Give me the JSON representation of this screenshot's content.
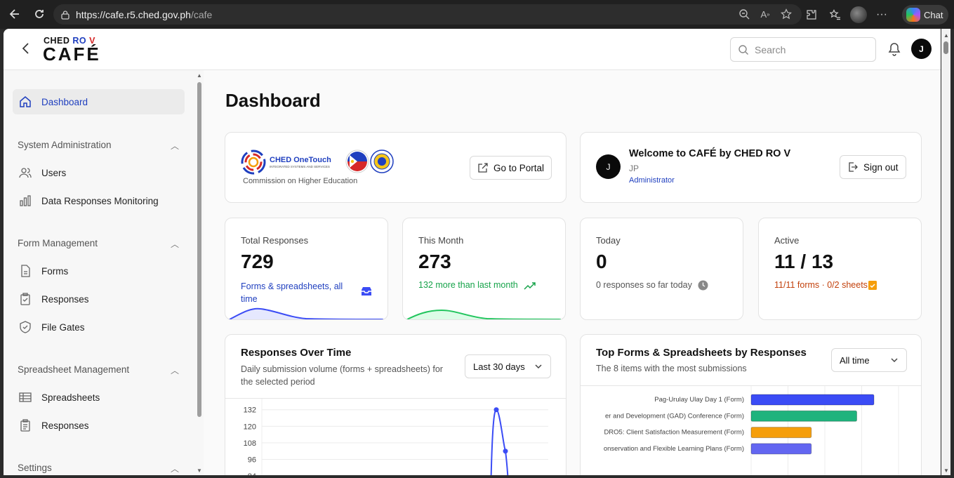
{
  "browser": {
    "url_host": "https://cafe.r5.ched.gov.ph",
    "url_path": "/cafe",
    "chat_label": "Chat"
  },
  "header": {
    "logo_top_ched": "CHED",
    "logo_top_ro": "RO",
    "logo_top_v": "V",
    "logo_main": "CAFÉ",
    "search_placeholder": "Search",
    "avatar_initial": "J"
  },
  "sidebar": {
    "dashboard": "Dashboard",
    "groups": {
      "system": "System Administration",
      "form": "Form Management",
      "spreadsheet": "Spreadsheet Management",
      "settings": "Settings"
    },
    "items": {
      "users": "Users",
      "data_monitoring": "Data Responses Monitoring",
      "forms": "Forms",
      "responses": "Responses",
      "file_gates": "File Gates",
      "spreadsheets": "Spreadsheets",
      "sheet_responses": "Responses"
    }
  },
  "main": {
    "title": "Dashboard",
    "portal_card": {
      "logo_text": "CHED OneTouch",
      "logo_sub": "INTEGRATED SYSTEMS AND SERVICES",
      "caption": "Commission on Higher Education",
      "button": "Go to Portal"
    },
    "welcome_card": {
      "avatar_initial": "J",
      "title": "Welcome to CAFÉ by CHED RO V",
      "name": "JP",
      "role": "Administrator",
      "button": "Sign out"
    },
    "stats": [
      {
        "label": "Total Responses",
        "value": "729",
        "sub": "Forms & spreadsheets, all time",
        "color": "#1f3fbf"
      },
      {
        "label": "This Month",
        "value": "273",
        "sub": "132 more than last month",
        "color": "#16a34a"
      },
      {
        "label": "Today",
        "value": "0",
        "sub": "0 responses so far today",
        "color": "#555555"
      },
      {
        "label": "Active",
        "value": "11 / 13",
        "sub": "11/11 forms · 0/2 sheets",
        "color": "#c2410c"
      }
    ],
    "responses_over_time": {
      "title": "Responses Over Time",
      "subtitle_1": "Daily submission volume (forms + spreadsheets) for",
      "subtitle_2": "the selected period",
      "range": "Last 30 days"
    },
    "top_forms": {
      "title": "Top Forms & Spreadsheets by Responses",
      "subtitle": "The 8 items with the most submissions",
      "range": "All time"
    }
  },
  "chart_data": [
    {
      "type": "line",
      "title": "Responses Over Time",
      "y_ticks": [
        84,
        96,
        108,
        120,
        132
      ],
      "ylim": [
        80,
        140
      ],
      "points_visible": [
        132,
        102
      ],
      "grid": true
    },
    {
      "type": "bar",
      "orientation": "horizontal",
      "title": "Top Forms & Spreadsheets by Responses",
      "categories": [
        "Pag-Urulay Ulay Day 1 (Form)",
        "er and Development (GAD) Conference (Form)",
        "DRO5: Client Satisfaction Measurement (Form)",
        "onservation and Flexible Learning Plans (Form)"
      ],
      "values": [
        100,
        86,
        49,
        49
      ],
      "colors": [
        "#3b4cf5",
        "#1fb37d",
        "#f59e0b",
        "#6366f1"
      ],
      "xlim": [
        0,
        120
      ]
    }
  ]
}
